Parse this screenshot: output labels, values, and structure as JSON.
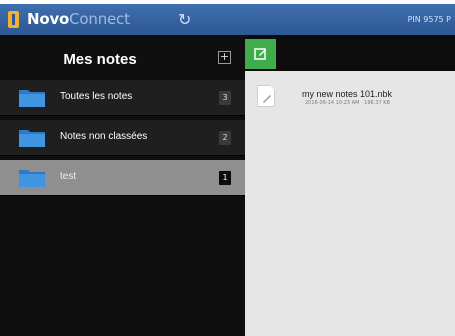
{
  "app": {
    "brand_bold": "Novo",
    "brand_light": "Connect",
    "pin_label": "PIN 9575 P"
  },
  "sidebar": {
    "title": "Mes notes",
    "add_label": "+",
    "folders": [
      {
        "label": "Toutes les notes",
        "count": "3",
        "selected": false
      },
      {
        "label": "Notes non classées",
        "count": "2",
        "selected": false
      },
      {
        "label": "test",
        "count": "1",
        "selected": true
      }
    ]
  },
  "notes": [
    {
      "title": "my new notes 101.nbk",
      "meta": "2016-06-14 10:23 AM · 196.37 KB"
    }
  ],
  "colors": {
    "topbar": "#2d5894",
    "brand_icon": "#f0b22a",
    "folder": "#3a8ad6",
    "edit_button": "#3fae4a",
    "selected_row": "#8f8f8f"
  }
}
